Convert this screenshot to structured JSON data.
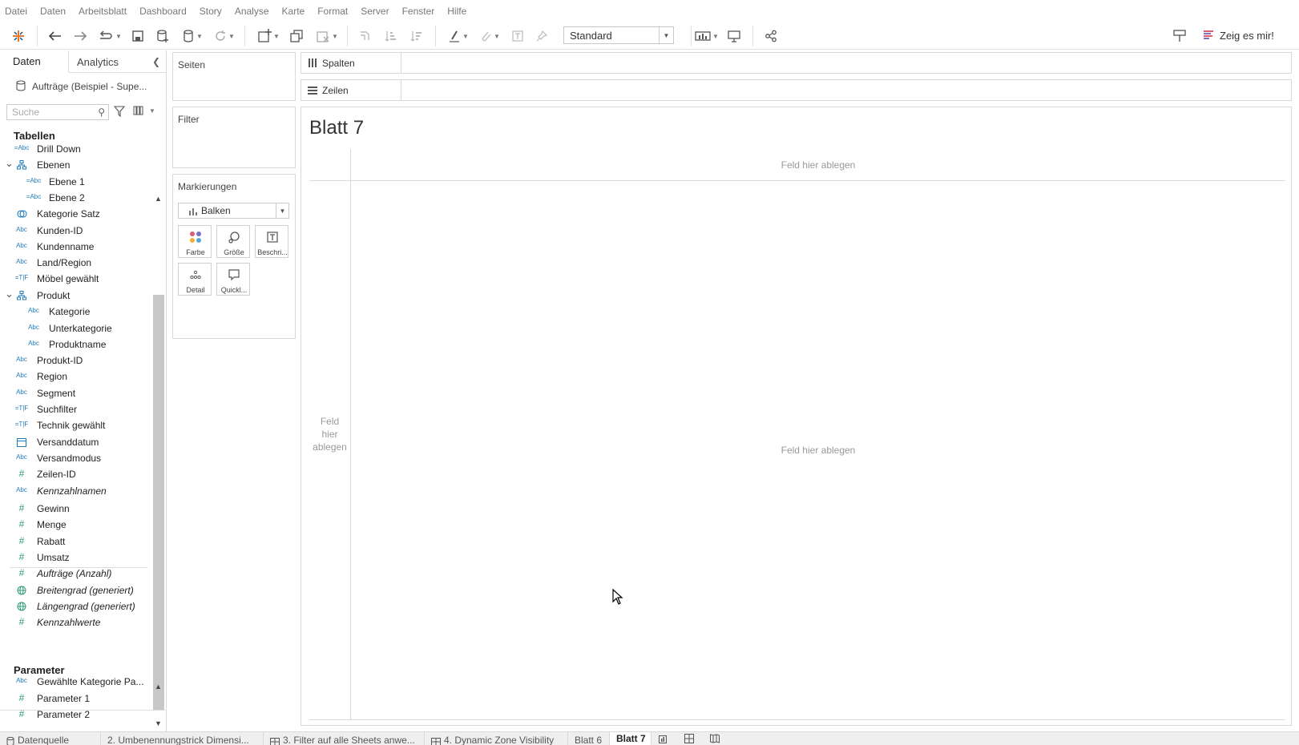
{
  "menu": [
    "Datei",
    "Daten",
    "Arbeitsblatt",
    "Dashboard",
    "Story",
    "Analyse",
    "Karte",
    "Format",
    "Server",
    "Fenster",
    "Hilfe"
  ],
  "toolbar": {
    "view_select": "Standard",
    "show_me": "Zeig es mir!"
  },
  "pane": {
    "tab_daten": "Daten",
    "tab_analytics": "Analytics",
    "datasource": "Aufträge (Beispiel - Supe...",
    "search_placeholder": "Suche",
    "tables_title": "Tabellen",
    "params_title": "Parameter",
    "fields": [
      {
        "name": "Drill Down",
        "type": "=Abc"
      },
      {
        "name": "Ebenen",
        "type": "hier"
      },
      {
        "name": "Ebene 1",
        "type": "=Abc"
      },
      {
        "name": "Ebene 2",
        "type": "=Abc"
      },
      {
        "name": "Kategorie Satz",
        "type": "set"
      },
      {
        "name": "Kunden-ID",
        "type": "Abc"
      },
      {
        "name": "Kundenname",
        "type": "Abc"
      },
      {
        "name": "Land/Region",
        "type": "Abc"
      },
      {
        "name": "Möbel gewählt",
        "type": "=T|F"
      },
      {
        "name": "Produkt",
        "type": "hier"
      },
      {
        "name": "Kategorie",
        "type": "Abc"
      },
      {
        "name": "Unterkategorie",
        "type": "Abc"
      },
      {
        "name": "Produktname",
        "type": "Abc"
      },
      {
        "name": "Produkt-ID",
        "type": "Abc"
      },
      {
        "name": "Region",
        "type": "Abc"
      },
      {
        "name": "Segment",
        "type": "Abc"
      },
      {
        "name": "Suchfilter",
        "type": "=T|F"
      },
      {
        "name": "Technik gewählt",
        "type": "=T|F"
      },
      {
        "name": "Versanddatum",
        "type": "date"
      },
      {
        "name": "Versandmodus",
        "type": "Abc"
      },
      {
        "name": "Zeilen-ID",
        "type": "#"
      },
      {
        "name": "Kennzahlnamen",
        "type": "Abc"
      },
      {
        "name": "Gewinn",
        "type": "#"
      },
      {
        "name": "Menge",
        "type": "#"
      },
      {
        "name": "Rabatt",
        "type": "#"
      },
      {
        "name": "Umsatz",
        "type": "#"
      },
      {
        "name": "Aufträge (Anzahl)",
        "type": "#"
      },
      {
        "name": "Breitengrad (generiert)",
        "type": "geo"
      },
      {
        "name": "Längengrad (generiert)",
        "type": "geo"
      },
      {
        "name": "Kennzahlwerte",
        "type": "#"
      }
    ],
    "params": [
      {
        "name": "Gewählte Kategorie Pa...",
        "type": "Abc"
      },
      {
        "name": "Parameter 1",
        "type": "#"
      },
      {
        "name": "Parameter 2",
        "type": "#"
      }
    ]
  },
  "cards": {
    "seiten": "Seiten",
    "filter": "Filter",
    "marks": "Markierungen",
    "mark_type": "Balken",
    "mark_buttons": [
      "Farbe",
      "Größe",
      "Beschri...",
      "Detail",
      "Quickl..."
    ]
  },
  "shelves": {
    "spalten": "Spalten",
    "zeilen": "Zeilen"
  },
  "canvas": {
    "title": "Blatt 7",
    "drop_top": "Feld hier ablegen",
    "drop_left": "Feld hier ablegen",
    "drop_center": "Feld hier ablegen"
  },
  "bottom_tabs": [
    "Datenquelle",
    "2. Umbenennungstrick Dimensi...",
    "3. Filter auf alle Sheets anwe...",
    "4. Dynamic Zone Visibility",
    "Blatt 6",
    "Blatt 7"
  ],
  "colors": {
    "dimension": "#1f7bbd",
    "measure": "#2c9a74"
  }
}
